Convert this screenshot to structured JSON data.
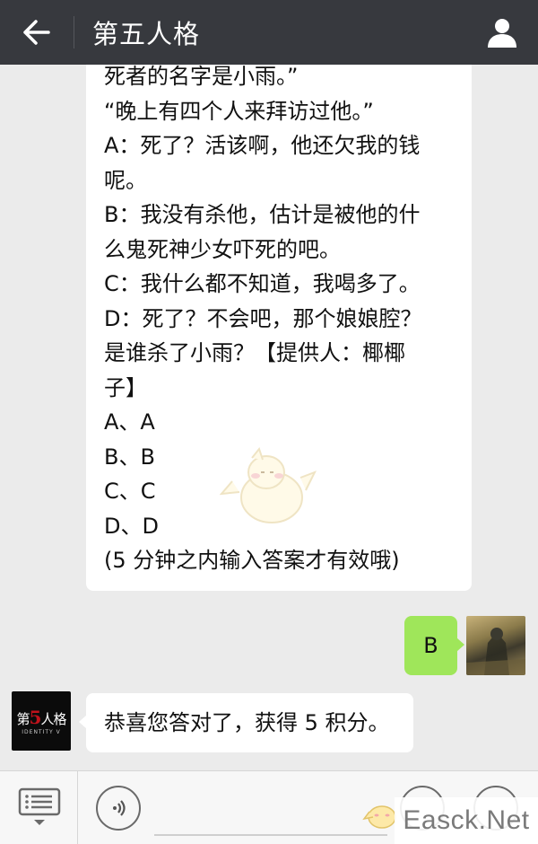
{
  "header": {
    "title": "第五人格",
    "back_icon": "arrow-left-icon",
    "profile_icon": "person-icon"
  },
  "messages": {
    "question_lines": [
      "死者的名字是小雨。”",
      "“晚上有四个人来拜访过他。”",
      "A：死了？活该啊，他还欠我的钱",
      "呢。",
      "B：我没有杀他，估计是被他的什",
      "么鬼死神少女吓死的吧。",
      "C：我什么都不知道，我喝多了。",
      "D：死了？不会吧，那个娘娘腔？",
      "是谁杀了小雨？【提供人：椰椰",
      "子】",
      "A、A",
      "B、B",
      "C、C",
      "D、D",
      "(5 分钟之内输入答案才有效哦)"
    ],
    "user_reply": "B",
    "bot_reply": "恭喜您答对了，获得 5 积分。",
    "bot_avatar_logo_a": "第",
    "bot_avatar_logo_five": "5",
    "bot_avatar_logo_b": "人格",
    "bot_avatar_sub": "IDENTITY V"
  },
  "toolbar": {
    "menu_icon": "menu-list-icon",
    "voice_icon": "voice-icon"
  },
  "watermark": {
    "text": "Easck.Net"
  },
  "colors": {
    "header_bg": "#37393e",
    "chat_bg": "#ebebeb",
    "outgoing_bubble": "#9fe65a",
    "incoming_bubble": "#ffffff"
  }
}
